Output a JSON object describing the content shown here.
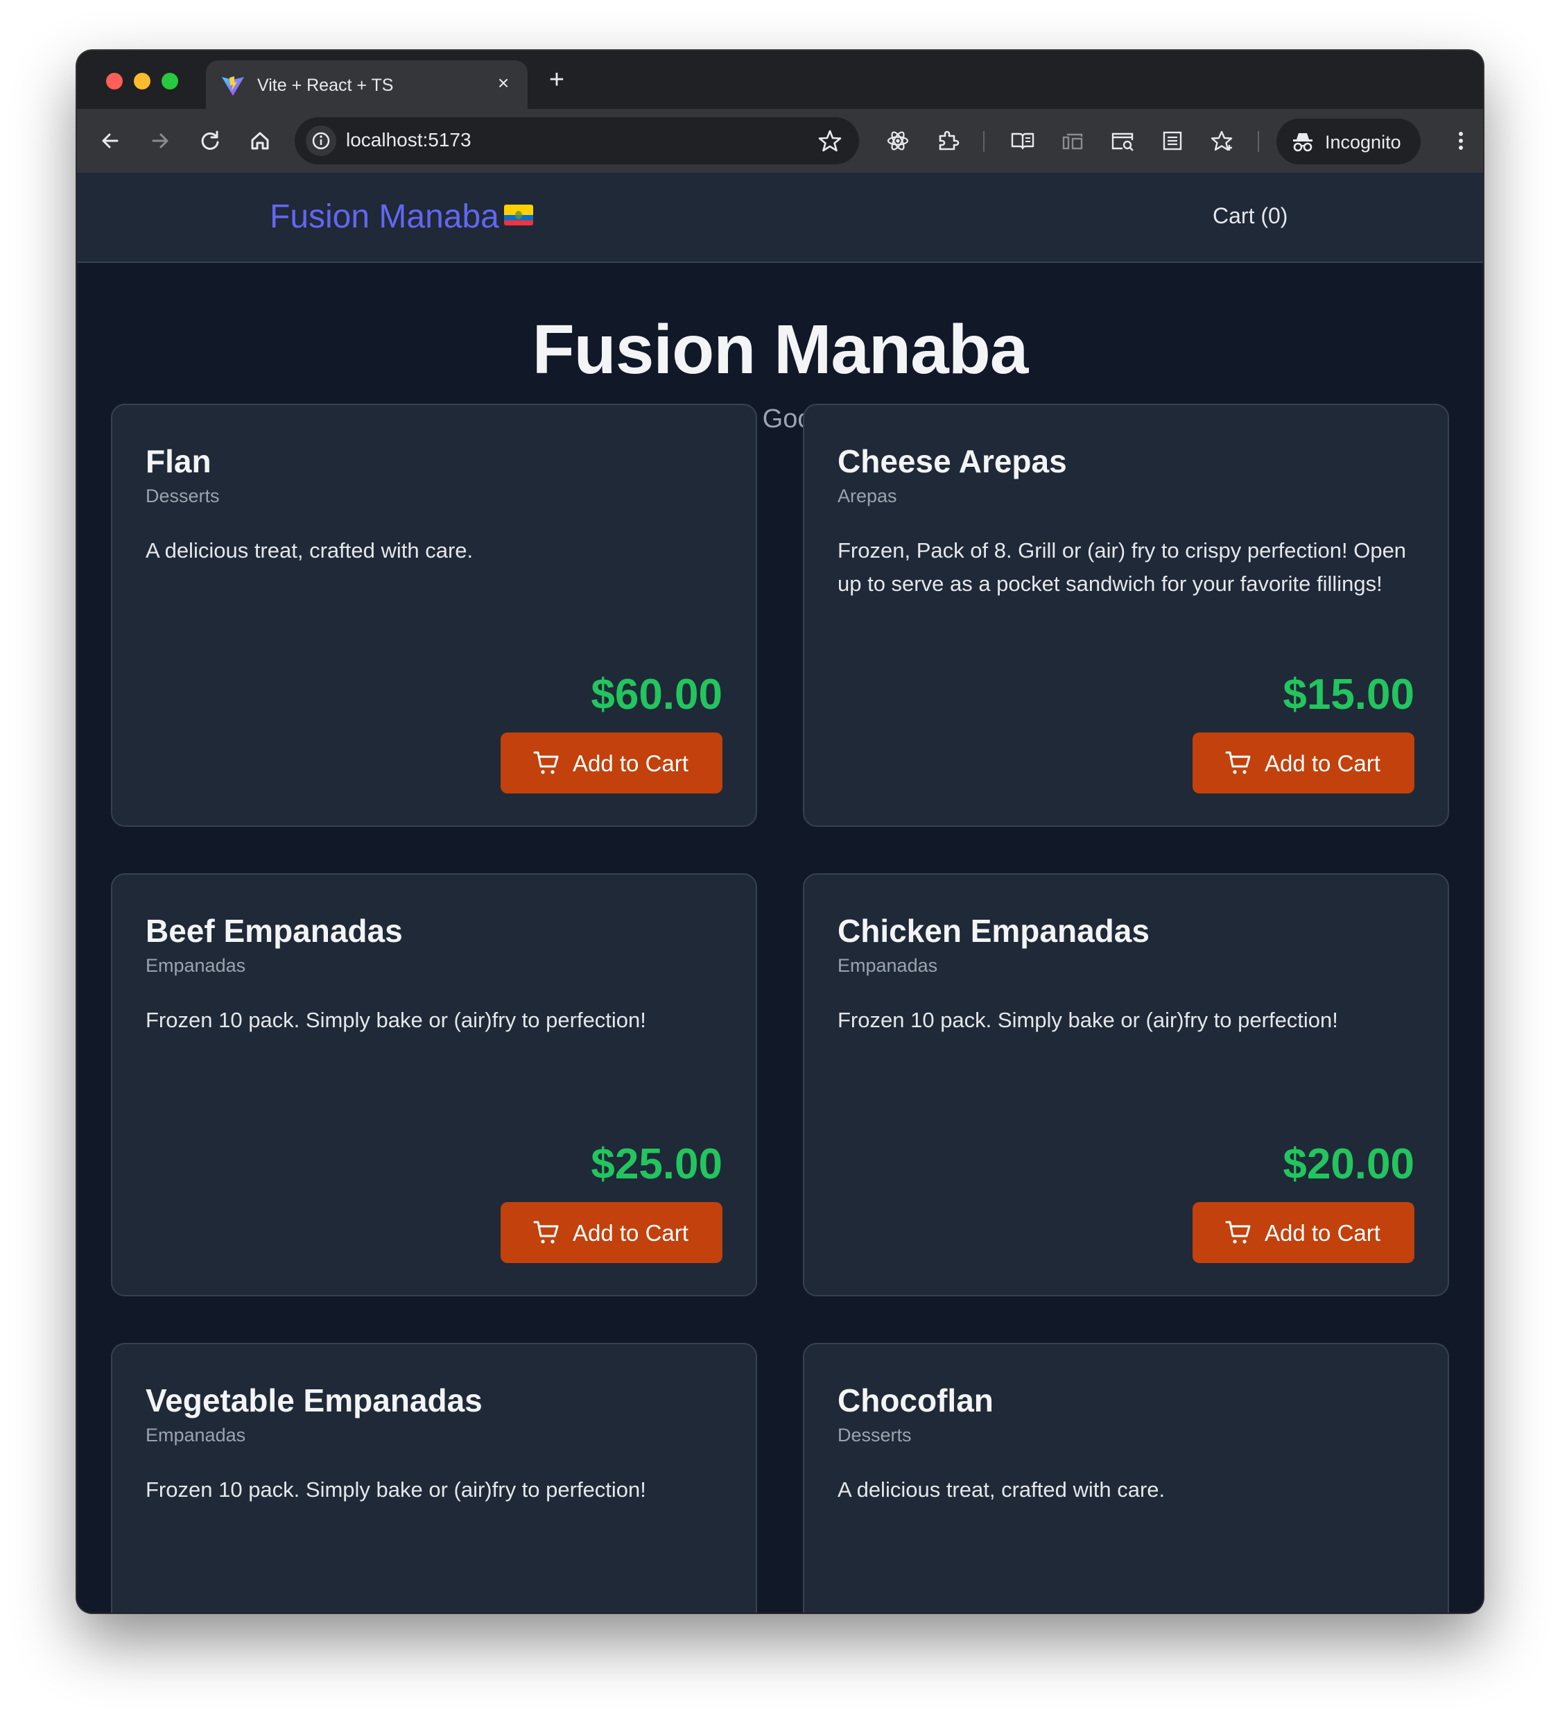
{
  "browser": {
    "tab_title": "Vite + React + TS",
    "url": "localhost:5173",
    "incognito_label": "Incognito"
  },
  "site": {
    "brand": "Fusion Manaba",
    "cart_label": "Cart (0)",
    "hero_title": "Fusion Manaba",
    "hero_subtitle": "Home-Baked Goods with Love",
    "add_to_cart_label": "Add to Cart",
    "accent_color": "#6366f1",
    "price_color": "#22c55e",
    "button_color": "#c2410c"
  },
  "products": [
    {
      "name": "Flan",
      "category": "Desserts",
      "description": "A delicious treat, crafted with care.",
      "price": "$60.00"
    },
    {
      "name": "Cheese Arepas",
      "category": "Arepas",
      "description": "Frozen, Pack of 8. Grill or (air) fry to crispy perfection! Open up to serve as a pocket sandwich for your favorite fillings!",
      "price": "$15.00"
    },
    {
      "name": "Beef Empanadas",
      "category": "Empanadas",
      "description": "Frozen 10 pack. Simply bake or (air)fry to perfection!",
      "price": "$25.00"
    },
    {
      "name": "Chicken Empanadas",
      "category": "Empanadas",
      "description": "Frozen 10 pack. Simply bake or (air)fry to perfection!",
      "price": "$20.00"
    },
    {
      "name": "Vegetable Empanadas",
      "category": "Empanadas",
      "description": "Frozen 10 pack. Simply bake or (air)fry to perfection!",
      "price": ""
    },
    {
      "name": "Chocoflan",
      "category": "Desserts",
      "description": "A delicious treat, crafted with care.",
      "price": ""
    }
  ]
}
